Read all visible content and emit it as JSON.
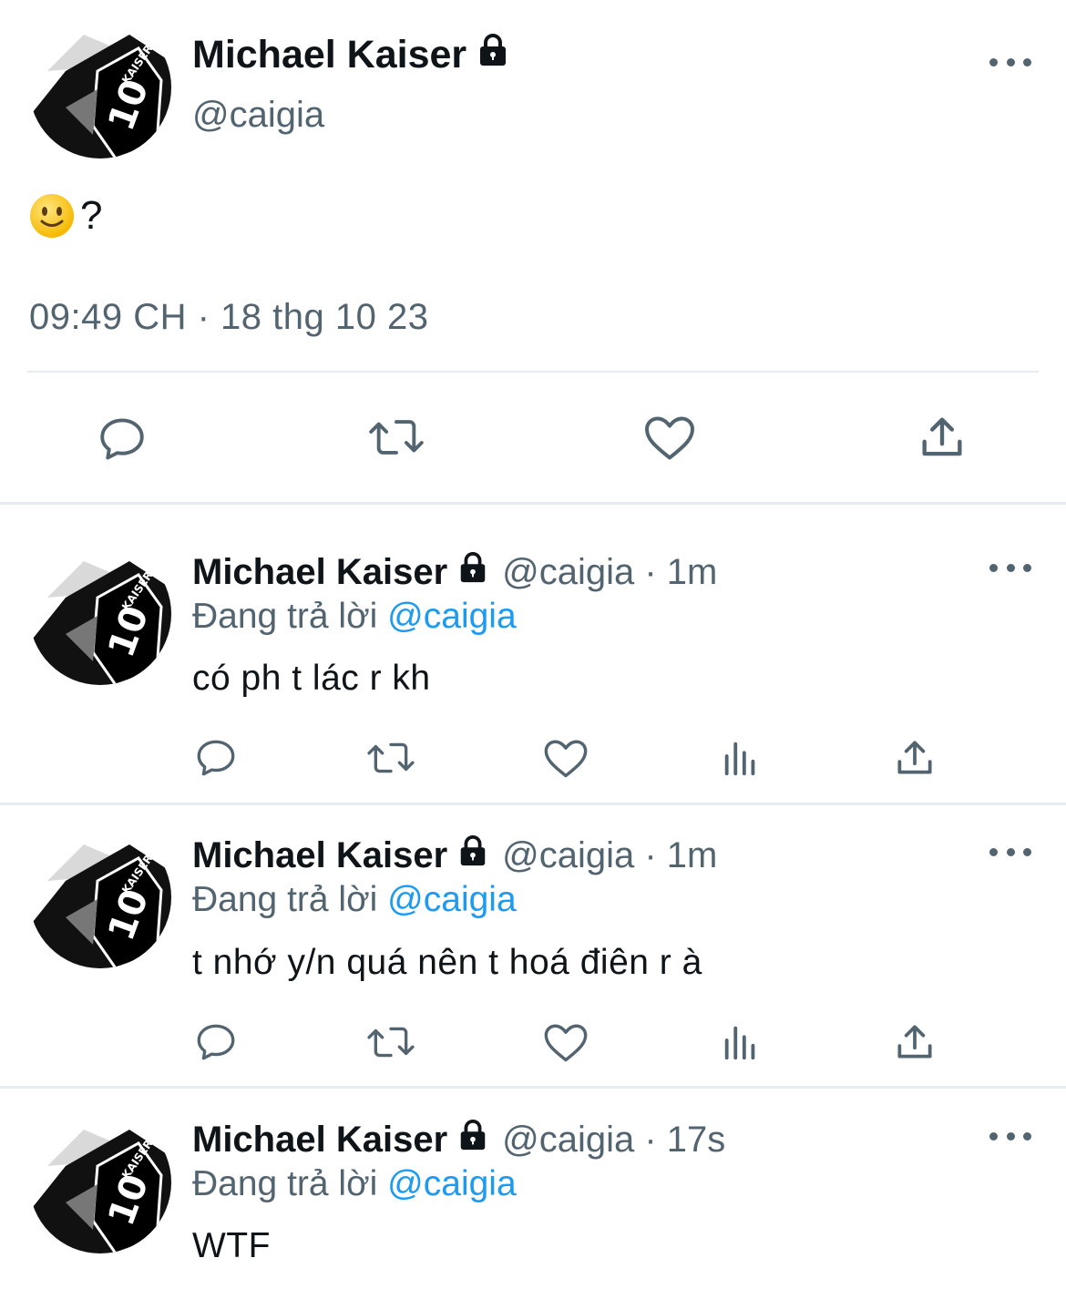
{
  "main_tweet": {
    "display_name": "Michael Kaiser",
    "handle": "@caigia",
    "text": "?",
    "emoji_icon": "slightly-smiling-face",
    "timestamp": "09:49 CH · 18 thg 10 23"
  },
  "replies": [
    {
      "display_name": "Michael Kaiser",
      "meta": "@caigia · 1m",
      "replying_prefix": "Đang trả lời",
      "replying_to": "@caigia",
      "text": "có ph t lác r kh"
    },
    {
      "display_name": "Michael Kaiser",
      "meta": "@caigia · 1m",
      "replying_prefix": "Đang trả lời",
      "replying_to": "@caigia",
      "text": "t nhớ y/n quá nên t hoá điên r à"
    },
    {
      "display_name": "Michael Kaiser",
      "meta": "@caigia · 17s",
      "replying_prefix": "Đang trả lời",
      "replying_to": "@caigia",
      "text": "WTF"
    }
  ],
  "colors": {
    "text": "#0f1419",
    "secondary": "#536471",
    "mention": "#1d9bf0",
    "divider": "#e6ecf0"
  },
  "icons": [
    "lock-icon",
    "more-icon",
    "reply-icon",
    "retweet-icon",
    "like-icon",
    "views-icon",
    "share-icon"
  ]
}
